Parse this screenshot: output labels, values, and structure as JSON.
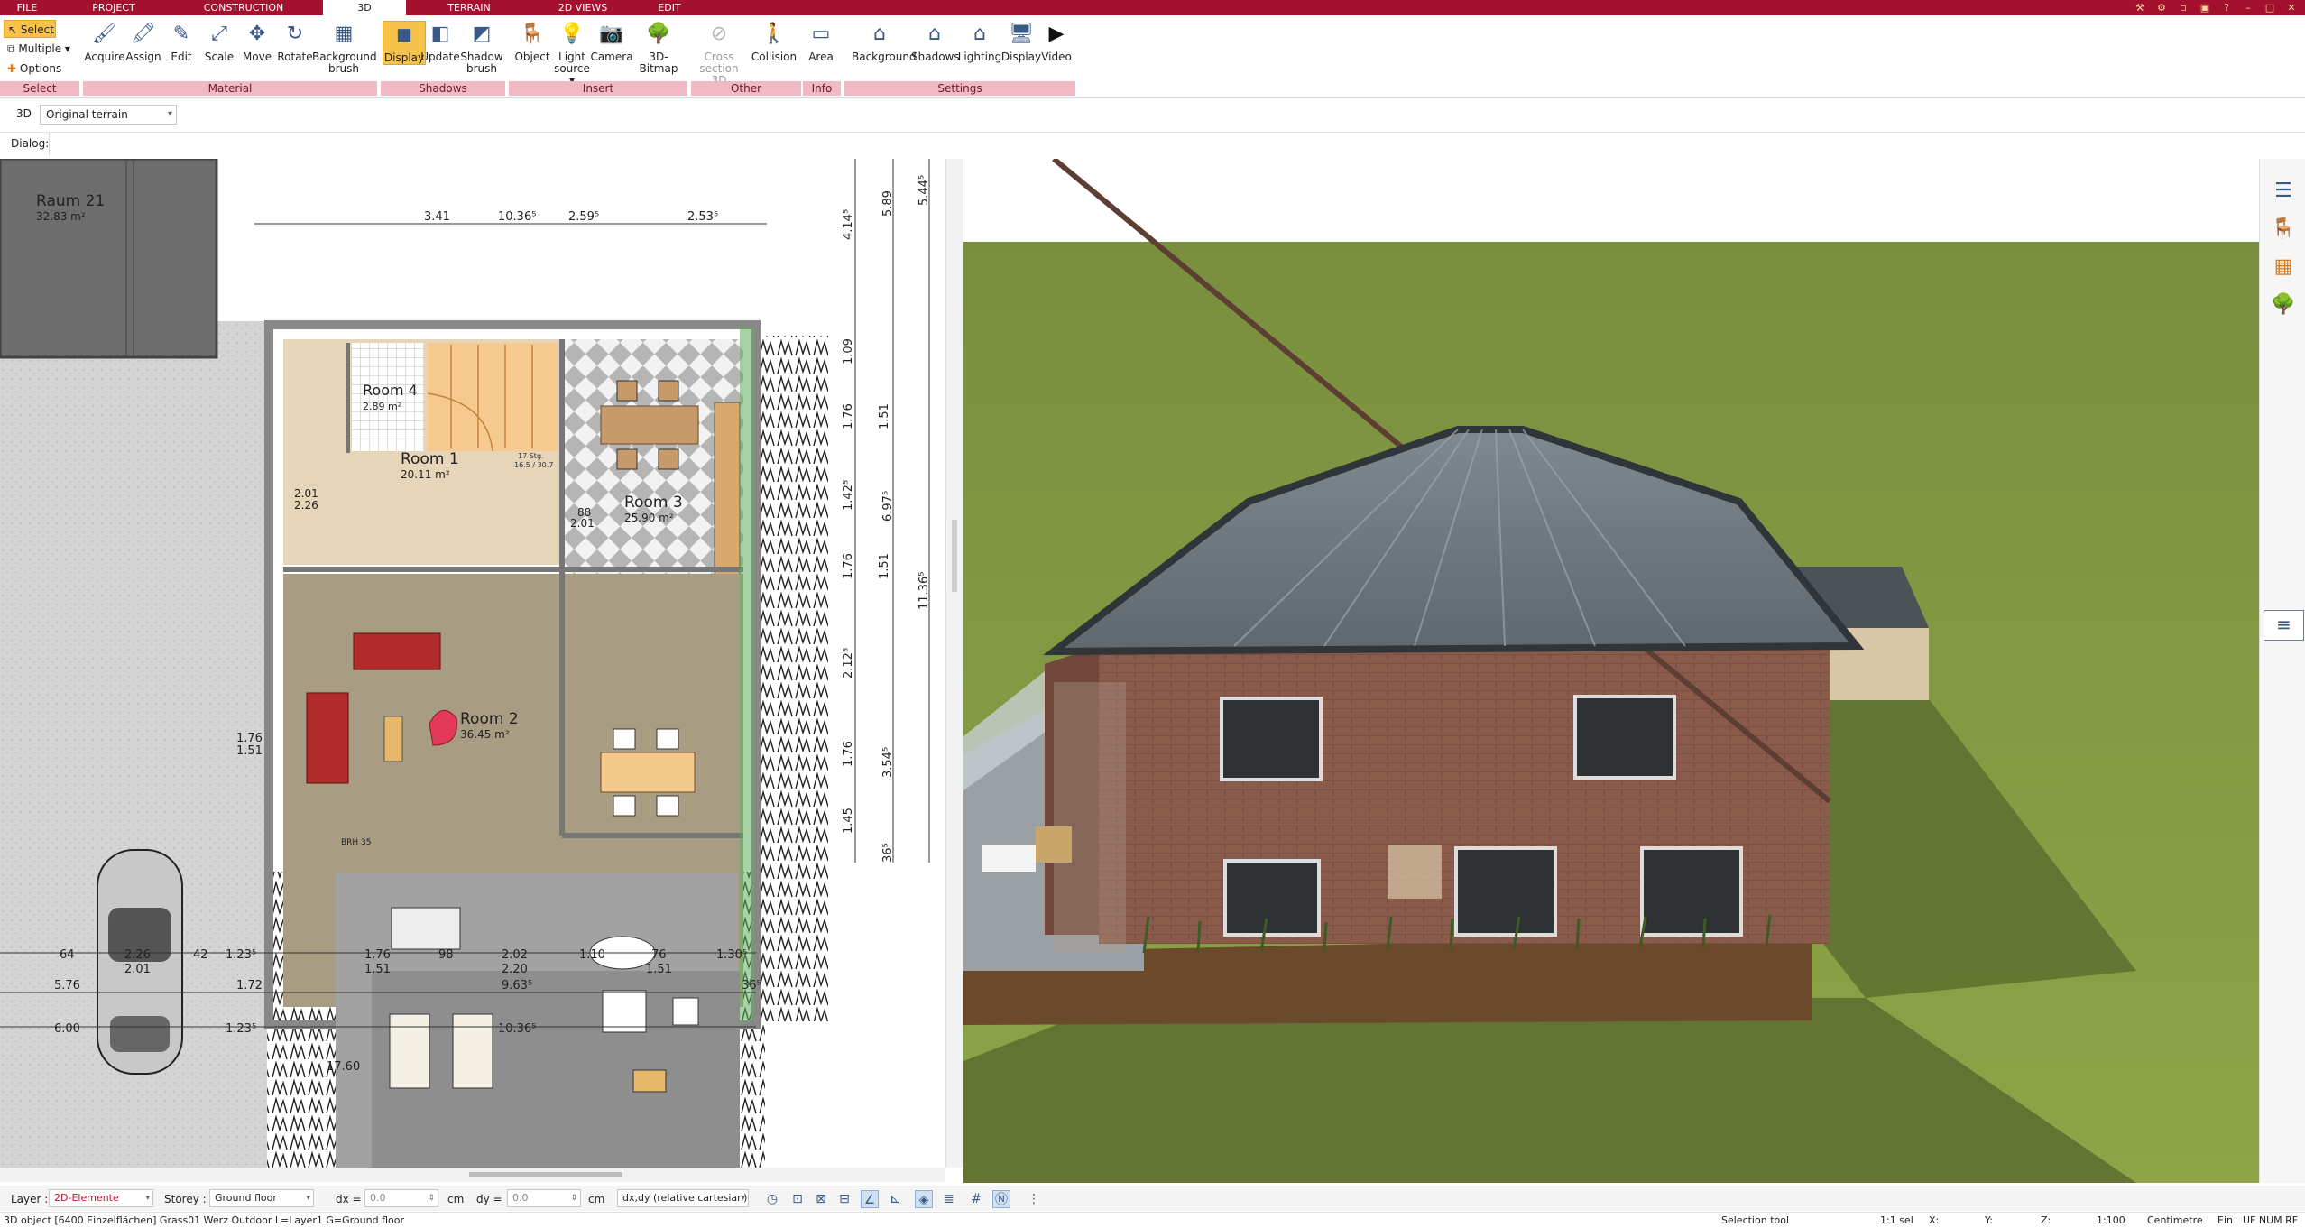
{
  "tabs": [
    "FILE",
    "PROJECT",
    "CONSTRUCTION",
    "3D",
    "TERRAIN",
    "2D VIEWS",
    "EDIT"
  ],
  "active_tab": "3D",
  "colors": {
    "tab_bar": "#a3112e",
    "group_label_bg": "#f1b9c3",
    "active_button": "#f7c24a",
    "grass": "#7b8f3e"
  },
  "ribbon": {
    "select_group": {
      "select": "Select",
      "multiple": "Multiple",
      "options": "Options",
      "label": "Select"
    },
    "material": {
      "label": "Material",
      "buttons": [
        "Acquire",
        "Assign",
        "Edit",
        "Scale",
        "Move",
        "Rotate",
        "Background brush"
      ]
    },
    "shadows": {
      "label": "Shadows",
      "buttons": [
        "Display",
        "Update",
        "Shadow brush"
      ]
    },
    "insert": {
      "label": "Insert",
      "buttons": [
        "Object",
        "Light source",
        "Camera",
        "3D-Bitmap"
      ]
    },
    "other": {
      "label": "Other",
      "buttons": [
        "Cross section 3D",
        "Collision"
      ]
    },
    "info": {
      "label": "Info",
      "buttons": [
        "Area"
      ]
    },
    "settings": {
      "label": "Settings",
      "buttons": [
        "Background",
        "Shadows",
        "Lighting",
        "Display",
        "Video"
      ]
    }
  },
  "viewbar": {
    "mode": "3D",
    "terrain": "Original terrain",
    "dialog_label": "Dialog:"
  },
  "plan": {
    "rooms": [
      {
        "name": "Raum 21",
        "area": "32.83 m²"
      },
      {
        "name": "Room 4",
        "area": "2.89 m²"
      },
      {
        "name": "Room 1",
        "area": "20.11 m²"
      },
      {
        "name": "Room 3",
        "area": "25.90 m²"
      },
      {
        "name": "Room 2",
        "area": "36.45 m²"
      }
    ],
    "dims_top": [
      "3.41",
      "10.36⁵",
      "2.59⁵",
      "2.53⁵"
    ],
    "dims_right": [
      "5.89",
      "4.14⁵",
      "5.44⁵",
      "1.09",
      "1.76",
      "1.51",
      "1.42⁵",
      "6.97⁵",
      "1.76",
      "1.51",
      "11.36⁵",
      "2.12⁵",
      "1.76",
      "3.54⁵",
      "1.45",
      "36⁵"
    ],
    "dims_bottom_row1": [
      "64",
      "2.26",
      "42",
      "1.23⁵",
      "1.76",
      "98",
      "2.02",
      "1.10",
      "76",
      "1.30⁵"
    ],
    "dims_bottom_row2": [
      "2.01",
      "1.51",
      "2.20",
      "1.51"
    ],
    "dims_bottom_row3": [
      "5.76",
      "1.72",
      "9.63⁵",
      "36⁵"
    ],
    "dims_bottom_row4": [
      "6.00",
      "1.23⁵",
      "10.36⁵"
    ],
    "misc_labels": [
      "2.01",
      "2.26",
      "88",
      "2.01",
      "BRH 35",
      "1.76",
      "1.51",
      "17.60",
      "1.76",
      "1.51",
      "17 Stg.",
      "16.5 / 30.7"
    ]
  },
  "bottombar": {
    "layer_label": "Layer :",
    "layer_value": "2D-Elemente",
    "storey_label": "Storey :",
    "storey_value": "Ground floor",
    "dx_label": "dx =",
    "dx_value": "0.0",
    "dy_label": "dy =",
    "dy_value": "0.0",
    "unit": "cm",
    "coord_mode": "dx,dy (relative cartesian)"
  },
  "statusbar": {
    "message": "3D object [6400 Einzelflächen] Grass01 Werz Outdoor L=Layer1 G=Ground floor",
    "tool": "Selection tool",
    "sel": "1:1 sel",
    "x": "X:",
    "y": "Y:",
    "z": "Z:",
    "scale": "1:100",
    "unit": "Centimetre",
    "ein": "Ein",
    "flags": "UF NUM RF"
  }
}
